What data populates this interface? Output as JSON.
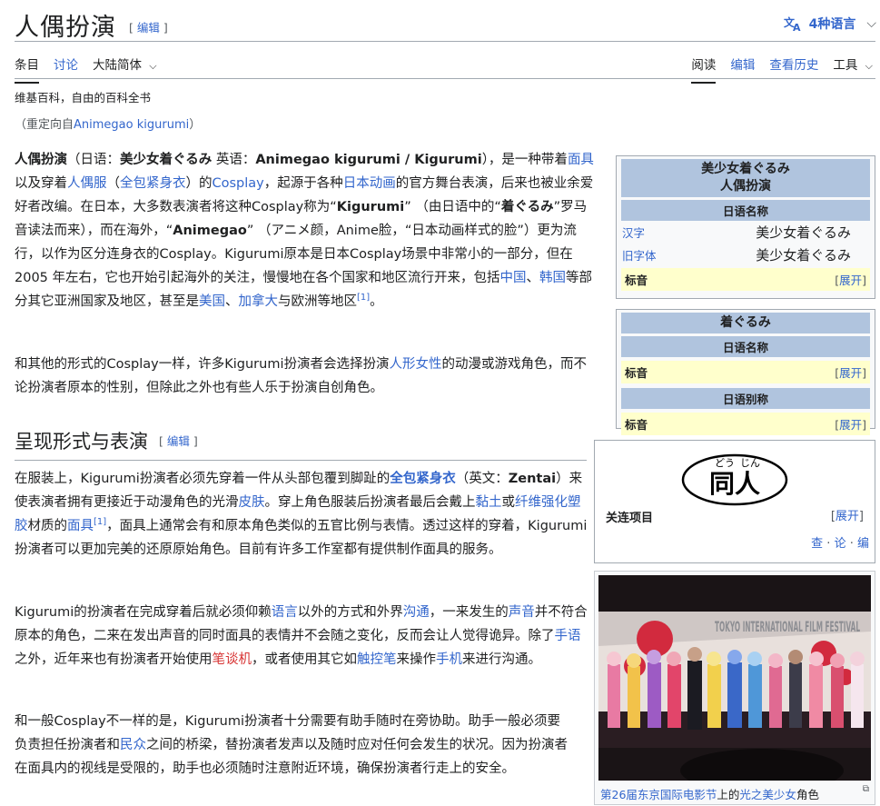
{
  "page": {
    "title": "人偶扮演",
    "edit_label": "编辑",
    "languages_label": "4种语言",
    "tabs_left": [
      "条目",
      "讨论",
      "大陆简体"
    ],
    "tabs_right": [
      "阅读",
      "编辑",
      "查看历史",
      "工具"
    ],
    "tagline": "维基百科，自由的百科全书",
    "redirect_prefix": "（重定向自",
    "redirect_link": "Animegao kigurumi",
    "redirect_suffix": "）"
  },
  "infobox1": {
    "title_line1": "美少女着ぐるみ",
    "title_line2": "人偶扮演",
    "section": "日语名称",
    "rows": [
      {
        "key": "汉字",
        "value": "美少女着ぐるみ"
      },
      {
        "key": "旧字体",
        "value": "美少女着ぐるみ"
      }
    ],
    "reading_label": "标音",
    "expand_label": "展开"
  },
  "infobox2": {
    "title": "着ぐるみ",
    "section1": "日语名称",
    "section2": "日语别称",
    "reading_label": "标音",
    "expand_label": "展开"
  },
  "navbox": {
    "logo_ruby_left": "どう",
    "logo_ruby_right": "じん",
    "logo_text": "同人",
    "label": "关连项目",
    "expand_label": "展开",
    "links": [
      "查",
      "论",
      "编"
    ]
  },
  "figure": {
    "caption_link1": "第26届东京国际电影节",
    "caption_mid": "上的",
    "caption_link2": "光之美少女",
    "caption_end": "角色",
    "sign_text": "TOKYO INTERNATIONAL FILM FESTIVAL"
  },
  "section2": {
    "heading": "呈现形式与表演",
    "edit_label": "编辑"
  },
  "colors": {
    "link": "#3366cc",
    "redlink": "#d73333",
    "infobox_header": "#b0c4de",
    "infobox_yellow": "#ffffcc"
  }
}
